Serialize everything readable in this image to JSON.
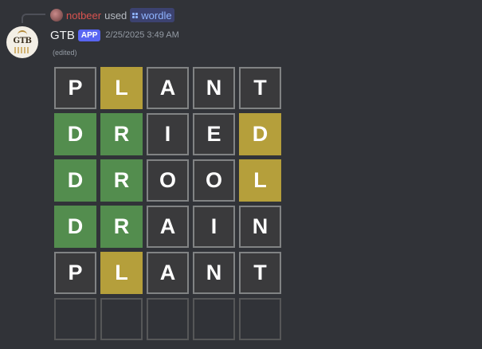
{
  "command": {
    "user": "notbeer",
    "used_text": "used",
    "command_name": "wordle"
  },
  "message": {
    "author": "GTB",
    "badge": "APP",
    "timestamp": "2/25/2025 3:49 AM",
    "edited": "(edited)",
    "avatar_text": "GTB"
  },
  "colors": {
    "correct": "#538d4e",
    "present": "#b59f3b",
    "absent": "#3a3a3c",
    "background": "#313338",
    "app_badge": "#5865f2"
  },
  "board": {
    "rows": [
      [
        {
          "letter": "P",
          "state": "absent"
        },
        {
          "letter": "L",
          "state": "present"
        },
        {
          "letter": "A",
          "state": "absent"
        },
        {
          "letter": "N",
          "state": "absent"
        },
        {
          "letter": "T",
          "state": "absent"
        }
      ],
      [
        {
          "letter": "D",
          "state": "correct"
        },
        {
          "letter": "R",
          "state": "correct"
        },
        {
          "letter": "I",
          "state": "absent"
        },
        {
          "letter": "E",
          "state": "absent"
        },
        {
          "letter": "D",
          "state": "present"
        }
      ],
      [
        {
          "letter": "D",
          "state": "correct"
        },
        {
          "letter": "R",
          "state": "correct"
        },
        {
          "letter": "O",
          "state": "absent"
        },
        {
          "letter": "O",
          "state": "absent"
        },
        {
          "letter": "L",
          "state": "present"
        }
      ],
      [
        {
          "letter": "D",
          "state": "correct"
        },
        {
          "letter": "R",
          "state": "correct"
        },
        {
          "letter": "A",
          "state": "absent"
        },
        {
          "letter": "I",
          "state": "absent"
        },
        {
          "letter": "N",
          "state": "absent"
        }
      ],
      [
        {
          "letter": "P",
          "state": "absent"
        },
        {
          "letter": "L",
          "state": "present"
        },
        {
          "letter": "A",
          "state": "absent"
        },
        {
          "letter": "N",
          "state": "absent"
        },
        {
          "letter": "T",
          "state": "absent"
        }
      ],
      [
        {
          "letter": "",
          "state": "empty"
        },
        {
          "letter": "",
          "state": "empty"
        },
        {
          "letter": "",
          "state": "empty"
        },
        {
          "letter": "",
          "state": "empty"
        },
        {
          "letter": "",
          "state": "empty"
        }
      ]
    ]
  }
}
